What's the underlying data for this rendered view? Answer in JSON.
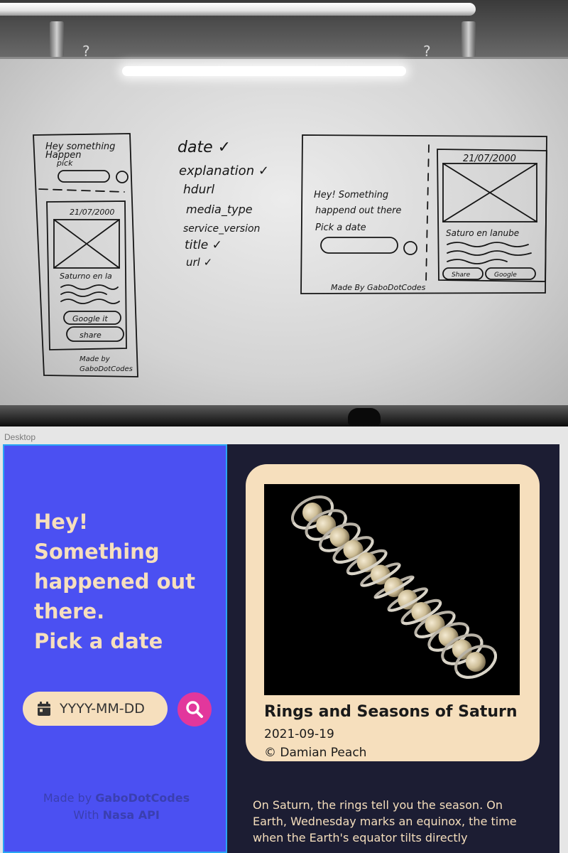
{
  "sketch": {
    "mobile": {
      "heading": [
        "Hey something",
        "Happen",
        "pick"
      ],
      "date": "21/07/2000",
      "title": "Saturno en la",
      "google_button": "Google it",
      "share_button": "share",
      "footer": [
        "Made by",
        "GaboDotCodes"
      ]
    },
    "fields": [
      "date ✓",
      "explanation ✓",
      "hdurl",
      "media_type",
      "service_version",
      "title ✓",
      "url ✓"
    ],
    "desktop": {
      "heading": [
        "Hey! Something",
        "happend out there",
        "Pick a date"
      ],
      "date": "21/07/2000",
      "title": "Saturo en lanube",
      "share_button": "Share",
      "google_button": "Google",
      "footer": "Made By GaboDotCodes"
    }
  },
  "design": {
    "frame_label": "Desktop",
    "headline": [
      "Hey!",
      "Something",
      "happened out",
      "there.",
      "Pick a date"
    ],
    "date_placeholder": "YYYY-MM-DD",
    "footer": {
      "made_by_prefix": "Made by ",
      "made_by_name": "GaboDotCodes",
      "api_prefix": "With ",
      "api_name": "Nasa API"
    },
    "card": {
      "title": "Rings and Seasons of Saturn",
      "date": "2021-09-19",
      "credit": "© Damian Peach"
    },
    "explanation": "On Saturn, the rings tell you the season. On Earth, Wednesday marks an equinox, the time when the Earth's equator tilts directly",
    "colors": {
      "left_panel": "#4b50f2",
      "right_panel": "#1c1d33",
      "accent_cream": "#f6dfbd",
      "search_button": "#e2379c"
    },
    "icons": {
      "date": "calendar-icon",
      "search": "search-icon"
    }
  }
}
